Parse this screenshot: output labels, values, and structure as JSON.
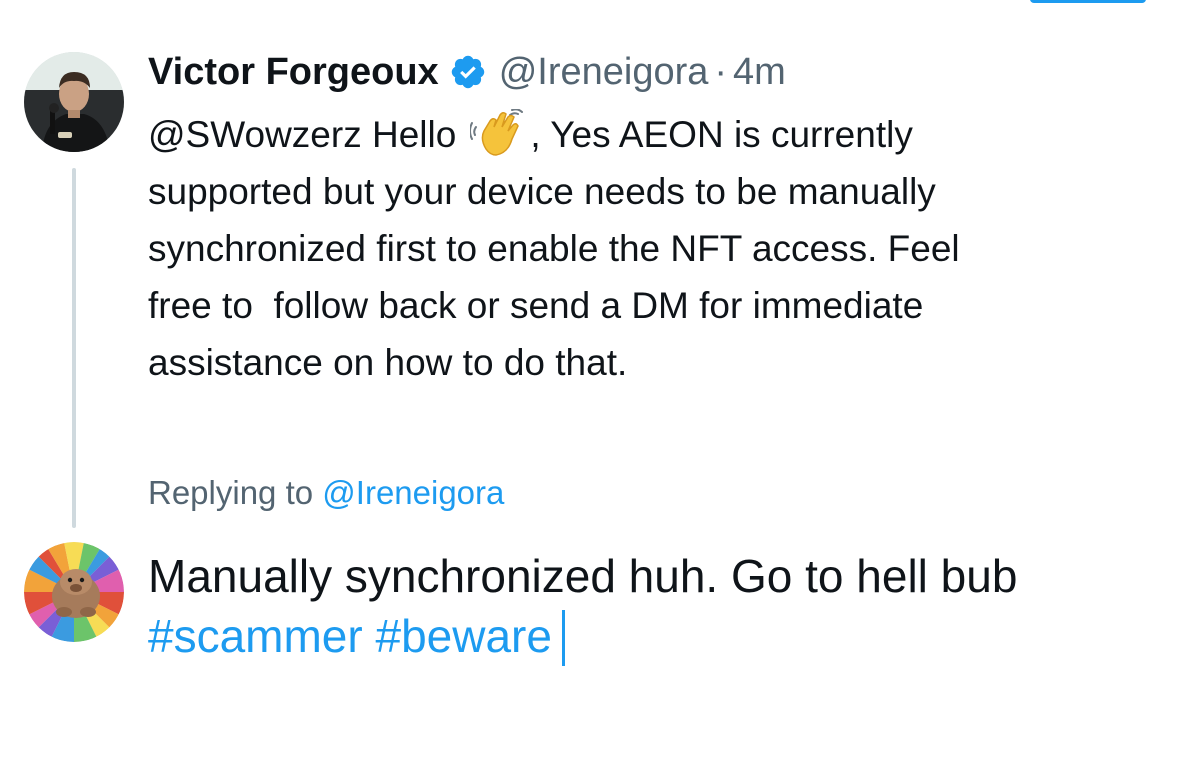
{
  "original_tweet": {
    "display_name": "Victor Forgeoux",
    "handle": "@Ireneigora",
    "separator": "·",
    "time": "4m",
    "body": {
      "mention": "@SWowzerz",
      "line1_before_emoji": "Hello",
      "line1_after_emoji": ", Yes AEON is currently",
      "line2": "supported but your device needs to be manually",
      "line3": "synchronized first to enable the NFT access. Feel",
      "line4": "free to  follow back or send a DM for immediate",
      "line5": "assistance on how to do that."
    },
    "emoji": "waving-hand"
  },
  "reply_composer": {
    "replying_label": "Replying to",
    "replying_to": "@Ireneigora",
    "text_line1": "Manually synchronized huh. Go to hell bub",
    "hashtag1": "#scammer",
    "hashtag2": "#beware"
  },
  "colors": {
    "accent": "#1d9bf0",
    "text_primary": "#0f1419",
    "text_secondary": "#536471",
    "thread_line": "#cfd9de"
  }
}
